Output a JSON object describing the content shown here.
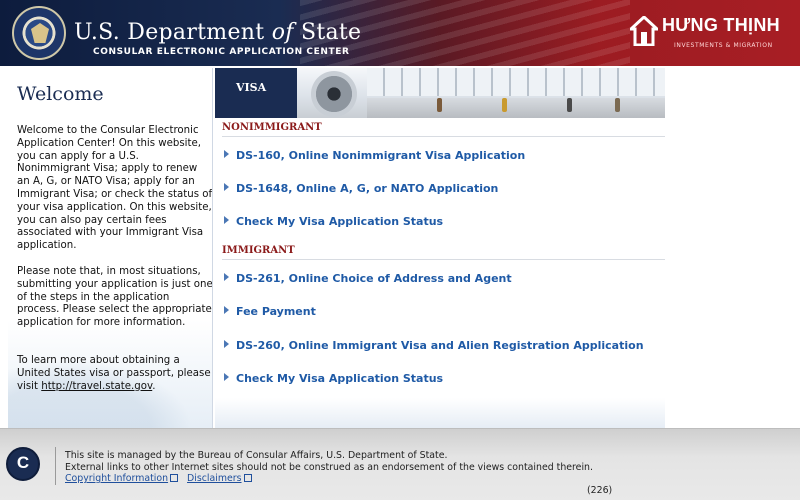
{
  "header": {
    "title_prefix": "U.S. Department ",
    "title_of": "of",
    "title_suffix": " State",
    "subtitle": "CONSULAR ELECTRONIC APPLICATION CENTER",
    "brand_name": "HƯNG THỊNH",
    "brand_tagline": "INVESTMENTS & MIGRATION"
  },
  "sidebar": {
    "heading": "Welcome",
    "p1": "Welcome to the Consular Electronic Application Center! On this website, you can apply for a U.S. Nonimmigrant Visa; apply to renew an A, G, or NATO Visa; apply for an Immigrant Visa; or check the status of your visa application. On this website, you can also pay certain fees associated with your Immigrant Visa application.",
    "p2": "Please note that, in most situations, submitting your application is just one of the steps in the application process. Please select the appropriate application for more information.",
    "p3_text": "To learn more about obtaining a United States visa or passport, please visit ",
    "p3_link": "http://travel.state.gov",
    "p3_end": "."
  },
  "main": {
    "tab_label": "VISA",
    "nonimmigrant": {
      "header": "NONIMMIGRANT",
      "links": [
        "DS-160, Online Nonimmigrant Visa Application",
        "DS-1648, Online A, G, or NATO Application",
        "Check My Visa Application Status"
      ]
    },
    "immigrant": {
      "header": "IMMIGRANT",
      "links": [
        "DS-261, Online Choice of Address and Agent",
        "Fee Payment",
        "DS-260, Online Immigrant Visa and Alien Registration Application",
        "Check My Visa Application Status"
      ]
    }
  },
  "footer": {
    "logo_letter": "C",
    "line1": "This site is managed by the Bureau of Consular Affairs, U.S. Department of State.",
    "line2": "External links to other Internet sites should not be construed as an endorsement of the views contained therein.",
    "link_copyright": "Copyright Information",
    "link_disclaimers": "Disclaimers",
    "count": "(226)"
  },
  "colors": {
    "navy": "#1a2c52",
    "link_blue": "#1f5aa6",
    "section_red": "#8b1a1a",
    "header_red": "#a81e24"
  }
}
